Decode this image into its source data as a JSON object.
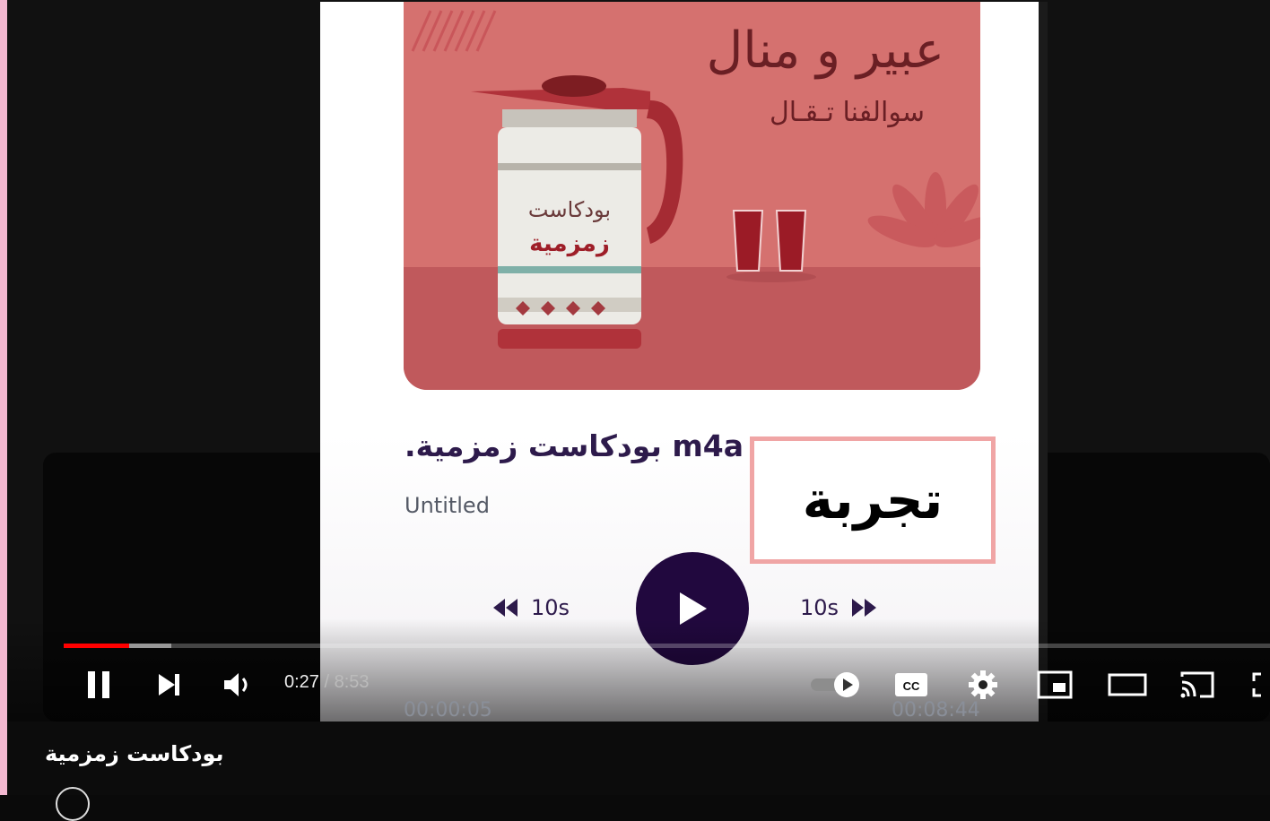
{
  "cover": {
    "title": "عبير و منال",
    "subtitle": "سوالفنا تـقـال",
    "pot_line1": "بودكاست",
    "pot_line2": "زمزمية"
  },
  "track": {
    "title": ".بودكاست زمزمية m4a",
    "subtitle": "Untitled"
  },
  "overlay_box_text": "تجربة",
  "player": {
    "rewind_label": "10s",
    "forward_label": "10s",
    "current_time": "00:00:05",
    "remaining_time": "00:08:44"
  },
  "youtube_controls": {
    "time_current": "0:27",
    "time_separator": " / ",
    "time_total": "8:53",
    "progress_played": 0.054,
    "progress_buffered": 0.089,
    "progress_color": "#ff0000"
  },
  "video_title": "بودكاست زمزمية",
  "icons": {
    "pause": "pause-icon",
    "next": "next-icon",
    "volume": "volume-icon",
    "autoplay": "autoplay-toggle-icon",
    "captions": "captions-icon",
    "settings": "gear-icon",
    "miniplayer": "miniplayer-icon",
    "theater": "theater-mode-icon",
    "cast": "cast-icon",
    "fullscreen": "fullscreen-icon"
  }
}
